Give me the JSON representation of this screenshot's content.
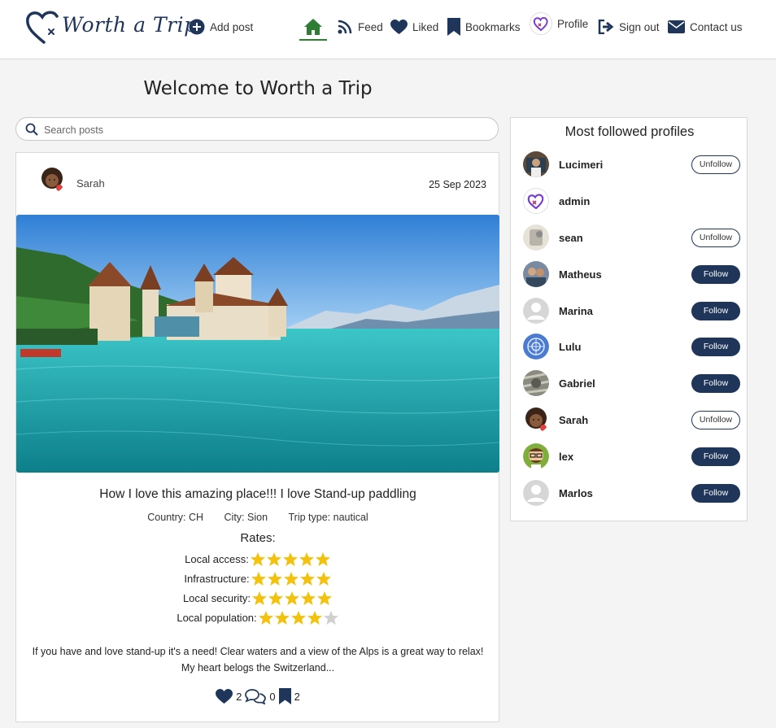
{
  "nav": {
    "logo_text": "Worth a Trip",
    "add_post": "Add post",
    "feed": "Feed",
    "liked": "Liked",
    "bookmarks": "Bookmarks",
    "profile": "Profile",
    "sign_out": "Sign out",
    "contact": "Contact us"
  },
  "page_title": "Welcome to Worth a Trip",
  "search": {
    "placeholder": "Search posts"
  },
  "post": {
    "author": "Sarah",
    "date": "25 Sep 2023",
    "title": "How I love this amazing place!!! I love Stand-up paddling",
    "country": "Country: CH",
    "city": "City: Sion",
    "trip_type": "Trip type: nautical",
    "rates_title": "Rates:",
    "rates": [
      {
        "label": "Local access:",
        "value": 5
      },
      {
        "label": "Infrastructure:",
        "value": 5
      },
      {
        "label": "Local security:",
        "value": 5
      },
      {
        "label": "Local population:",
        "value": 4
      }
    ],
    "body_line1": "If you have and love stand-up it's a need! Clear waters and a view of the Alps is a great way to relax!",
    "body_line2": "My heart belogs the Switzerland...",
    "likes": "2",
    "comments": "0",
    "bookmarks": "2"
  },
  "sidebar": {
    "title": "Most followed profiles",
    "profiles": [
      {
        "name": "Lucimeri",
        "button": "Unfollow"
      },
      {
        "name": "admin",
        "button": ""
      },
      {
        "name": "sean",
        "button": "Unfollow"
      },
      {
        "name": "Matheus",
        "button": "Follow"
      },
      {
        "name": "Marina",
        "button": "Follow"
      },
      {
        "name": "Lulu",
        "button": "Follow"
      },
      {
        "name": "Gabriel",
        "button": "Follow"
      },
      {
        "name": "Sarah",
        "button": "Unfollow"
      },
      {
        "name": "lex",
        "button": "Follow"
      },
      {
        "name": "Marlos",
        "button": "Follow"
      }
    ]
  },
  "colors": {
    "brand": "#1f3559",
    "home_active": "#2e7d32",
    "star": "#f4c20d",
    "star_empty": "#d0d0d0"
  }
}
